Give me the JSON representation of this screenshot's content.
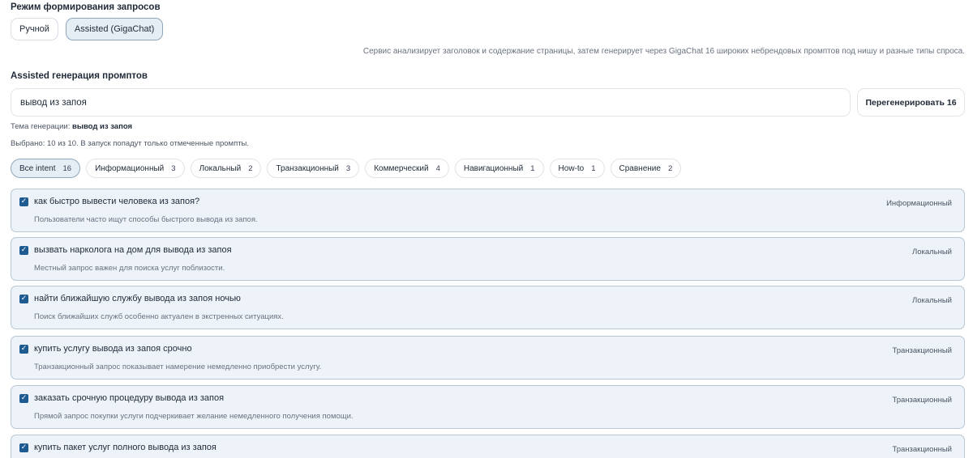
{
  "mode": {
    "title": "Режим формирования запросов",
    "manual_label": "Ручной",
    "assisted_label": "Assisted (GigaChat)",
    "description": "Сервис анализирует заголовок и содержание страницы, затем генерирует через GigaChat 16 широких небрендовых промптов под нишу и разные типы спроса."
  },
  "assisted": {
    "title": "Assisted генерация промптов",
    "query_value": "вывод из запоя",
    "regenerate_label": "Перегенерировать 16",
    "topic_label": "Тема генерации:",
    "topic_value": "вывод из запоя",
    "selected_text": "Выбрано: 10 из 10. В запуск попадут только отмеченные промпты."
  },
  "filters": [
    {
      "label": "Все intent",
      "count": "16"
    },
    {
      "label": "Информационный",
      "count": "3"
    },
    {
      "label": "Локальный",
      "count": "2"
    },
    {
      "label": "Транзакционный",
      "count": "3"
    },
    {
      "label": "Коммерческий",
      "count": "4"
    },
    {
      "label": "Навигационный",
      "count": "1"
    },
    {
      "label": "How-to",
      "count": "1"
    },
    {
      "label": "Сравнение",
      "count": "2"
    }
  ],
  "prompts": [
    {
      "title": "как быстро вывести человека из запоя?",
      "description": "Пользователи часто ищут способы быстрого вывода из запоя.",
      "tag": "Информационный"
    },
    {
      "title": "вызвать нарколога на дом для вывода из запоя",
      "description": "Местный запрос важен для поиска услуг поблизости.",
      "tag": "Локальный"
    },
    {
      "title": "найти ближайшую службу вывода из запоя ночью",
      "description": "Поиск ближайших служб особенно актуален в экстренных ситуациях.",
      "tag": "Локальный"
    },
    {
      "title": "купить услугу вывода из запоя срочно",
      "description": "Транзакционный запрос показывает намерение немедленно приобрести услугу.",
      "tag": "Транзакционный"
    },
    {
      "title": "заказать срочную процедуру вывода из запоя",
      "description": "Прямой запрос покупки услуги подчеркивает желание немедленного получения помощи.",
      "tag": "Транзакционный"
    },
    {
      "title": "купить пакет услуг полного вывода из запоя",
      "description": "",
      "tag": "Транзакционный"
    }
  ],
  "icons": {
    "checkbox": "checkmark-icon"
  },
  "colors": {
    "accent": "#1e5b91",
    "card_bg": "#edf3f8",
    "card_border": "#b7c7d6",
    "chip_active_bg": "#e6eef5"
  }
}
